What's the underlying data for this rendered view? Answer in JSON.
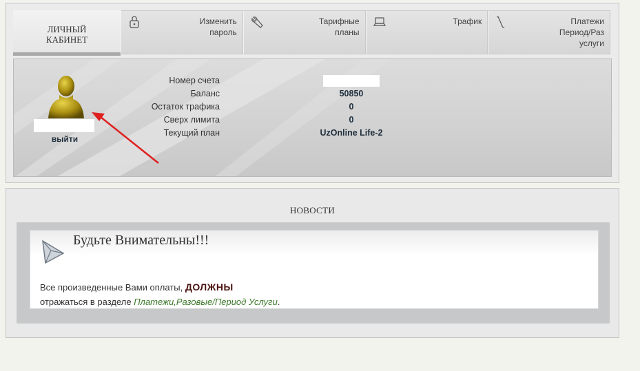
{
  "nav": {
    "home_label": "ЛИЧНЫЙ\nКАБИНЕТ",
    "tabs": [
      {
        "label": "Изменить\nпароль",
        "icon": "lock-icon"
      },
      {
        "label": "Тарифные\nпланы",
        "icon": "wrench-icon"
      },
      {
        "label": "Трафик",
        "icon": "laptop-icon"
      },
      {
        "label": "Платежи\nПериод/Раз\nуслуги",
        "icon": "wand-icon"
      }
    ]
  },
  "account": {
    "logout_label": "выйти",
    "labels": [
      "Номер счета",
      "Баланс",
      "Остаток трафика",
      "Сверх лимита",
      "Текущий план"
    ],
    "balance": "50850",
    "traffic_left": "0",
    "over_limit": "0",
    "plan": "UzOnline Life-2"
  },
  "news": {
    "section_title": "НОВОСТИ",
    "headline": "Будьте Внимательны!!!",
    "body_prefix": "Все произведенные Вами оплаты, ",
    "body_strong": "ДОЛЖНЫ",
    "body_line2": "отражаться в разделе ",
    "body_link": "Платежи,Разовые/Период Услуги",
    "body_end": "."
  },
  "colors": {
    "arrow": "#e02020",
    "link": "#3d7a2c",
    "emphasis": "#4a1210"
  }
}
